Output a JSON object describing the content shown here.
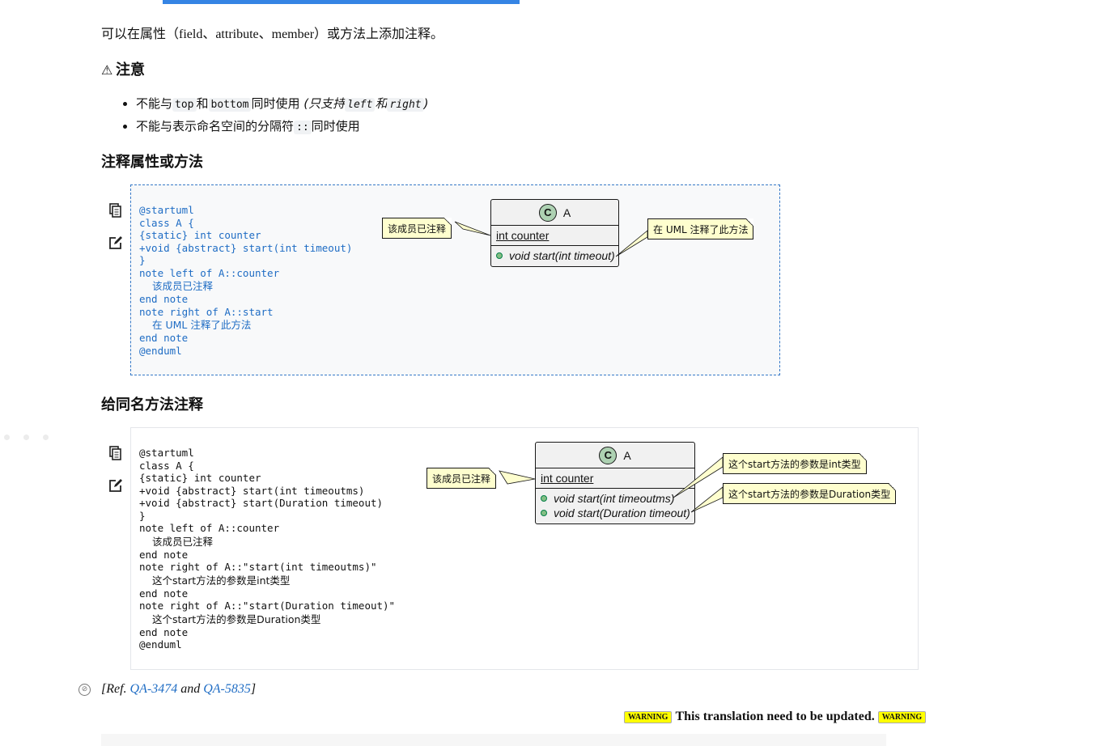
{
  "intro": "可以在属性（field、attribute、member）或方法上添加注释。",
  "warning_heading": {
    "icon": "warning-triangle-icon",
    "text": "注意"
  },
  "warning_items": [
    {
      "parts": {
        "a": "不能与",
        "code1": "top",
        "b": "和",
        "code2": "bottom",
        "c": "同时使用",
        "it1": "(只支持",
        "code3": "left",
        "it2": "和",
        "code4": "right",
        "it3": ")"
      }
    },
    {
      "parts": {
        "a": "不能与表示命名空间的分隔符",
        "code1": "::",
        "b": "同时使用"
      }
    }
  ],
  "section1": {
    "title": "注释属性或方法",
    "code": [
      "@startuml",
      "class A {",
      "{static} int counter",
      "+void {abstract} start(int timeout)",
      "}",
      "note left of A::counter",
      "该成员已注释",
      "end note",
      "note right of A::start",
      "在 UML 注释了此方法",
      "end note",
      "@enduml"
    ],
    "diagram": {
      "class_name": "A",
      "class_badge": "C",
      "field": "int counter",
      "methods": [
        "void start(int timeout)"
      ],
      "note_left": "该成员已注释",
      "note_right": "在 UML 注释了此方法"
    }
  },
  "section2": {
    "title": "给同名方法注释",
    "code": [
      "@startuml",
      "class A {",
      "{static} int counter",
      "+void {abstract} start(int timeoutms)",
      "+void {abstract} start(Duration timeout)",
      "}",
      "note left of A::counter",
      "该成员已注释",
      "end note",
      "note right of A::\"start(int timeoutms)\"",
      "这个start方法的参数是int类型",
      "end note",
      "note right of A::\"start(Duration timeout)\"",
      "这个start方法的参数是Duration类型",
      "end note",
      "@enduml"
    ],
    "diagram": {
      "class_name": "A",
      "class_badge": "C",
      "field": "int counter",
      "methods": [
        "void start(int timeoutms)",
        "void start(Duration timeout)"
      ],
      "note_left": "该成员已注释",
      "note_right1": "这个start方法的参数是int类型",
      "note_right2": "这个start方法的参数是Duration类型"
    }
  },
  "ref": {
    "prefix": "[Ref.",
    "link1": "QA-3474",
    "mid": "and",
    "link2": "QA-5835",
    "suffix": "]"
  },
  "warning_banner": {
    "badge": "WARNING",
    "text": "This translation need to be updated."
  }
}
